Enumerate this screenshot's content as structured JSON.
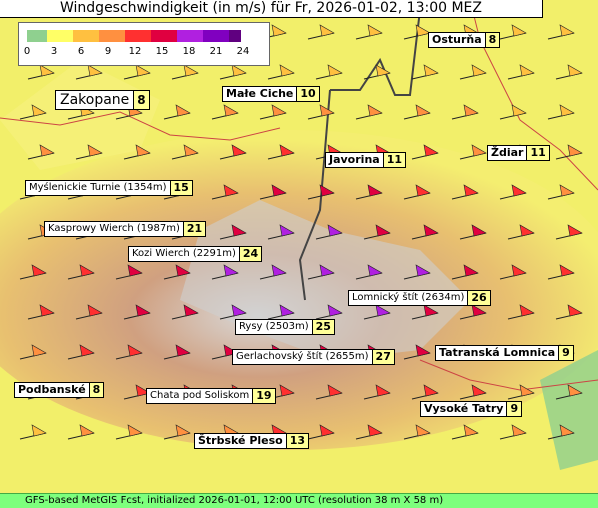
{
  "title": "Windgeschwindigkeit (in m/s) für Fr, 2026-01-02, 13:00 MEZ",
  "legend": {
    "ticks": [
      "0",
      "3",
      "6",
      "9",
      "12",
      "15",
      "18",
      "21",
      "24"
    ],
    "colors": [
      "#8fd08f",
      "#ffff66",
      "#ffc040",
      "#ff9040",
      "#ff3030",
      "#e00040",
      "#b020e0",
      "#8000c0",
      "#600080"
    ]
  },
  "places": [
    {
      "name": "Osturňa",
      "value": "8"
    },
    {
      "name": "Zakopane",
      "value": "8"
    },
    {
      "name": "Małe Ciche",
      "value": "10"
    },
    {
      "name": "Javorina",
      "value": "11"
    },
    {
      "name": "Ždiar",
      "value": "11"
    },
    {
      "name": "Myślenickie Turnie (1354m)",
      "value": "15"
    },
    {
      "name": "Kasprowy Wierch (1987m)",
      "value": "21"
    },
    {
      "name": "Kozi Wierch (2291m)",
      "value": "24"
    },
    {
      "name": "Lomnický štít (2634m)",
      "value": "26"
    },
    {
      "name": "Rysy (2503m)",
      "value": "25"
    },
    {
      "name": "Gerlachovský štít (2655m)",
      "value": "27"
    },
    {
      "name": "Tatranská Lomnica",
      "value": "9"
    },
    {
      "name": "Podbanské",
      "value": "8"
    },
    {
      "name": "Chata pod Soliskom",
      "value": "19"
    },
    {
      "name": "Vysoké Tatry",
      "value": "9"
    },
    {
      "name": "Štrbské Pleso",
      "value": "13"
    }
  ],
  "footer": "GFS-based MetGIS Fcst, initialized 2026-01-01, 12:00 UTC  (resolution 38 m X 58 m)"
}
